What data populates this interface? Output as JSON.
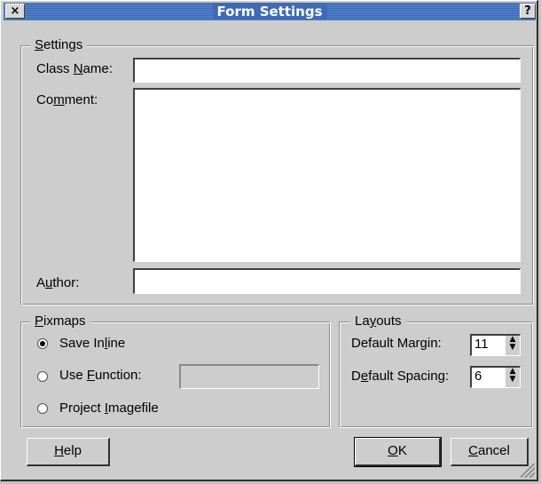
{
  "window": {
    "title": "Form Settings",
    "close_glyph": "×",
    "help_glyph": "?"
  },
  "settings": {
    "group_title_pre": "",
    "group_title_mn": "S",
    "group_title_post": "ettings",
    "class_name_pre": "Class ",
    "class_name_mn": "N",
    "class_name_post": "ame:",
    "class_name_value": "",
    "comment_pre": "Co",
    "comment_mn": "m",
    "comment_post": "ment:",
    "comment_value": "",
    "author_pre": "A",
    "author_mn": "u",
    "author_post": "thor:",
    "author_value": ""
  },
  "pixmaps": {
    "group_title_mn": "P",
    "group_title_post": "ixmaps",
    "options": [
      {
        "pre": "Save In",
        "mn": "l",
        "post": "ine",
        "selected": true
      },
      {
        "pre": "Use ",
        "mn": "F",
        "post": "unction:",
        "selected": false
      },
      {
        "pre": "Project ",
        "mn": "I",
        "post": "magefile",
        "selected": false
      }
    ],
    "function_value": ""
  },
  "layouts": {
    "group_title_pre": "La",
    "group_title_mn": "y",
    "group_title_post": "outs",
    "margin_pre": "Default Mar",
    "margin_mn": "g",
    "margin_post": "in:",
    "margin_value": "11",
    "spacing_pre": "D",
    "spacing_mn": "e",
    "spacing_post": "fault Spacing:",
    "spacing_value": "6"
  },
  "buttons": {
    "help_mn": "H",
    "help_post": "elp",
    "ok_mn": "O",
    "ok_post": "K",
    "cancel_mn": "C",
    "cancel_post": "ancel"
  }
}
